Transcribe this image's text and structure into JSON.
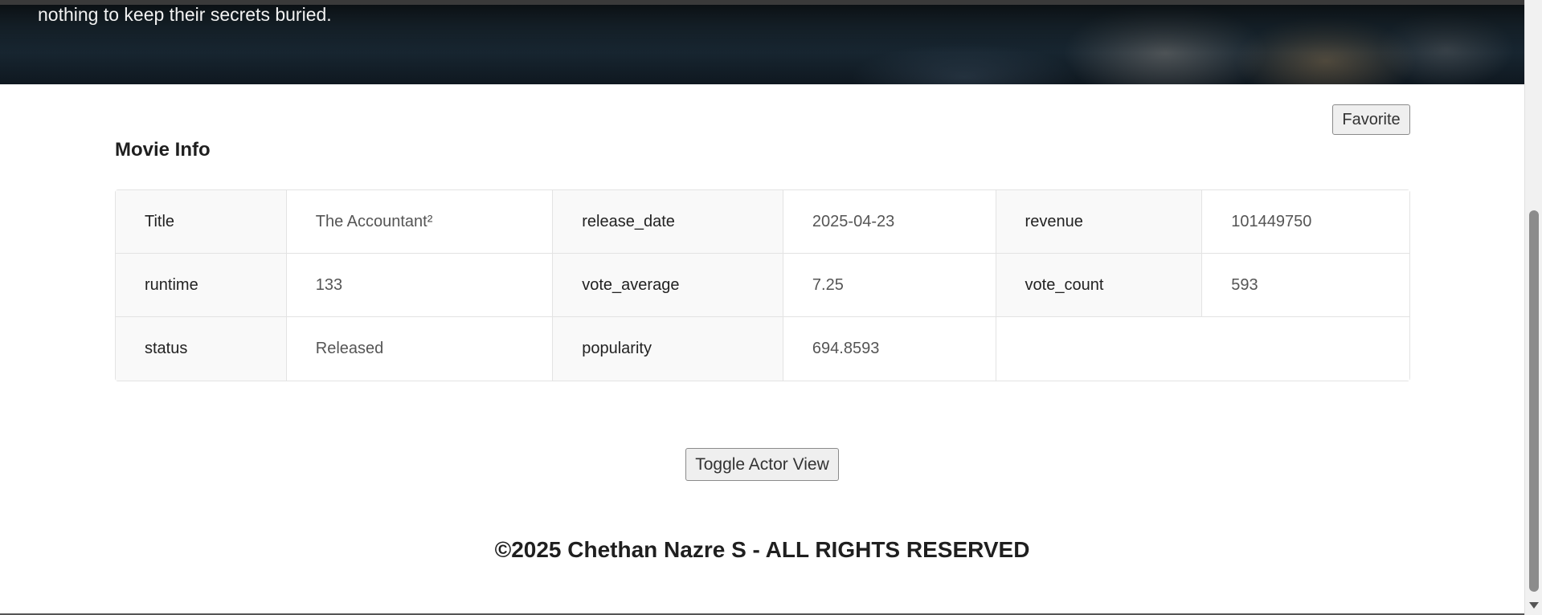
{
  "hero": {
    "overview_tail": "nothing to keep their secrets buried."
  },
  "actions": {
    "favorite_label": "Favorite",
    "toggle_actor_label": "Toggle Actor View"
  },
  "movie_info": {
    "title": "Movie Info",
    "rows": [
      [
        {
          "key": "Title",
          "value": "The Accountant²"
        },
        {
          "key": "release_date",
          "value": "2025-04-23"
        },
        {
          "key": "revenue",
          "value": "101449750"
        }
      ],
      [
        {
          "key": "runtime",
          "value": "133"
        },
        {
          "key": "vote_average",
          "value": "7.25"
        },
        {
          "key": "vote_count",
          "value": "593"
        }
      ],
      [
        {
          "key": "status",
          "value": "Released"
        },
        {
          "key": "popularity",
          "value": "694.8593"
        }
      ]
    ]
  },
  "footer": {
    "copyright": "©2025 Chethan Nazre S - ALL RIGHTS RESERVED"
  }
}
